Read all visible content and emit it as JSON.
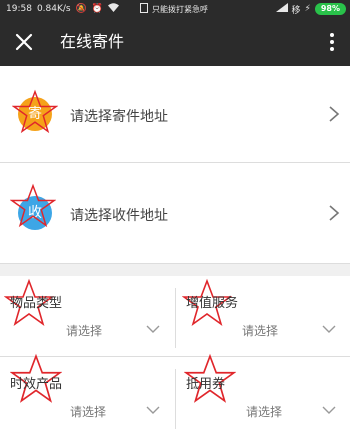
{
  "status_bar": {
    "time": "19:58",
    "speed": "0.84K/s",
    "notice": "只能拨打紧急呼",
    "carrier": "移",
    "battery": "98%"
  },
  "appbar": {
    "title": "在线寄件"
  },
  "sender": {
    "badge": "寄",
    "label": "请选择寄件地址",
    "badge_color": "#f5a21a"
  },
  "receiver": {
    "badge": "收",
    "label": "请选择收件地址",
    "badge_color": "#3da6e6"
  },
  "options": [
    {
      "title": "物品类型",
      "value": "请选择"
    },
    {
      "title": "增值服务",
      "value": "请选择"
    },
    {
      "title": "时效产品",
      "value": "请选择"
    },
    {
      "title": "抵用券",
      "value": "请选择"
    }
  ],
  "colors": {
    "header_bg": "#2b2b2b",
    "battery": "#29c24a",
    "annotation_star": "#e0262b"
  }
}
